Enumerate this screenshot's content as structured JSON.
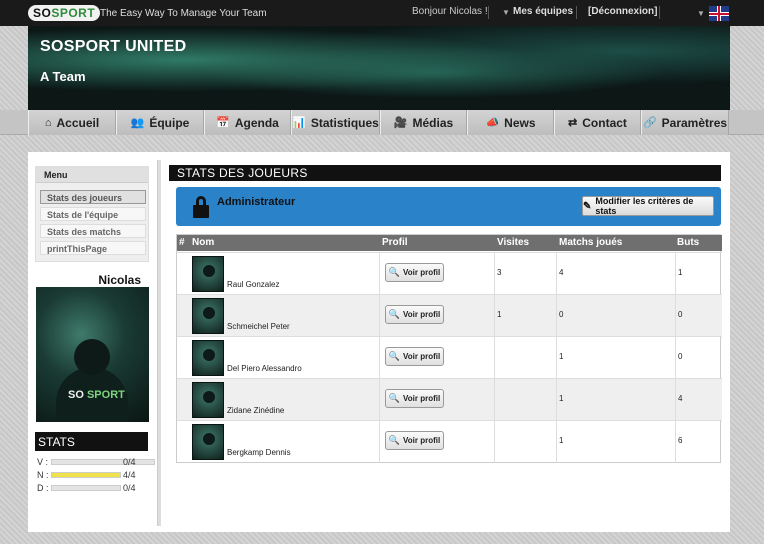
{
  "topbar": {
    "logo_so": "SO",
    "logo_sport": "SPORT",
    "tagline": "The Easy Way To Manage Your Team",
    "greeting": "Bonjour Nicolas !",
    "my_teams": "Mes équipes",
    "logout": "[Déconnexion]",
    "language_icon": "uk-flag-icon"
  },
  "banner": {
    "team_name": "SOSPORT UNITED",
    "team_sub": "A Team"
  },
  "nav": {
    "items": [
      {
        "label": "Accueil",
        "icon": "⌂"
      },
      {
        "label": "Équipe",
        "icon": "👥"
      },
      {
        "label": "Agenda",
        "icon": "📅"
      },
      {
        "label": "Statistiques",
        "icon": "📊"
      },
      {
        "label": "Médias",
        "icon": "🎥"
      },
      {
        "label": "News",
        "icon": "📣"
      },
      {
        "label": "Contact",
        "icon": "⇄"
      },
      {
        "label": "Paramètres",
        "icon": "🔗"
      }
    ]
  },
  "menu": {
    "title": "Menu",
    "items": [
      "Stats des joueurs",
      "Stats de l'équipe",
      "Stats des matchs",
      "printThisPage"
    ]
  },
  "profile": {
    "name": "Nicolas",
    "photo_brand_so": "SO",
    "photo_brand_sport": "SPORT"
  },
  "stats": {
    "title": "STATS",
    "rows": [
      {
        "label": "V :",
        "value": "0/4",
        "fraction": 0
      },
      {
        "label": "N :",
        "value": "4/4",
        "fraction": 1
      },
      {
        "label": "D :",
        "value": "0/4",
        "fraction": 0
      }
    ]
  },
  "content": {
    "section_title": "STATS DES JOUEURS",
    "admin_label": "Administrateur",
    "modify_button": "Modifier les critères de stats",
    "table": {
      "headers": [
        "#",
        "Nom",
        "Profil",
        "Visites",
        "Matchs joués",
        "Buts"
      ],
      "view_label": "Voir profil",
      "rows": [
        {
          "name": "Raul Gonzalez",
          "visits": "3",
          "matches": "4",
          "goals": "1"
        },
        {
          "name": "Schmeichel Peter",
          "visits": "1",
          "matches": "0",
          "goals": "0"
        },
        {
          "name": "Del Piero Alessandro",
          "visits": "",
          "matches": "1",
          "goals": "0"
        },
        {
          "name": "Zidane Zinédine",
          "visits": "",
          "matches": "1",
          "goals": "4"
        },
        {
          "name": "Bergkamp Dennis",
          "visits": "",
          "matches": "1",
          "goals": "6"
        }
      ]
    }
  }
}
